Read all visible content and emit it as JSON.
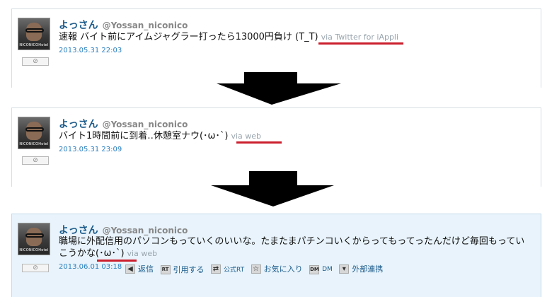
{
  "tweets": [
    {
      "user_name": "よっさん",
      "handle": "@Yossan_niconico",
      "text": "速報 バイト前にアイムジャグラー打ったら13000円負け (T_T)",
      "via": "via Twitter for iAppli",
      "timestamp": "2013.05.31 22:03",
      "avatar_tag": "NICONICOHotel"
    },
    {
      "user_name": "よっさん",
      "handle": "@Yossan_niconico",
      "text": "バイト1時間前に到着‥休憩室ナウ(･ω･`)",
      "via": "via web",
      "timestamp": "2013.05.31 23:09",
      "avatar_tag": "NICONICOHotel"
    },
    {
      "user_name": "よっさん",
      "handle": "@Yossan_niconico",
      "text": "職場に外配信用のパソコンもっていくのいいな。たまたまパチンコいくからってもってったんだけど毎回もっていこうかな(･ω･`)",
      "via": "via web",
      "timestamp": "2013.06.01 03:18",
      "avatar_tag": "NICONICOHotel"
    }
  ],
  "stop_glyph": "⊘",
  "actions": {
    "reply_label": "返信",
    "rt_icon": "RT",
    "quote_label": "引用する",
    "official_rt_label": "公式RT",
    "favorite_label": "お気に入り",
    "dm_icon": "DM",
    "dm_label": "DM",
    "external_label": "外部連携"
  },
  "colors": {
    "highlight_underline": "#cc1f2d",
    "username": "#1a5a8a",
    "timestamp": "#2a7fbf",
    "active_row_bg": "#e8f3fb"
  },
  "icons": {
    "arrow": "down-arrow-icon",
    "reply": "reply-arrow-icon",
    "retweet": "retweet-icon",
    "favorite": "star-icon",
    "menu": "chevron-down-icon"
  }
}
